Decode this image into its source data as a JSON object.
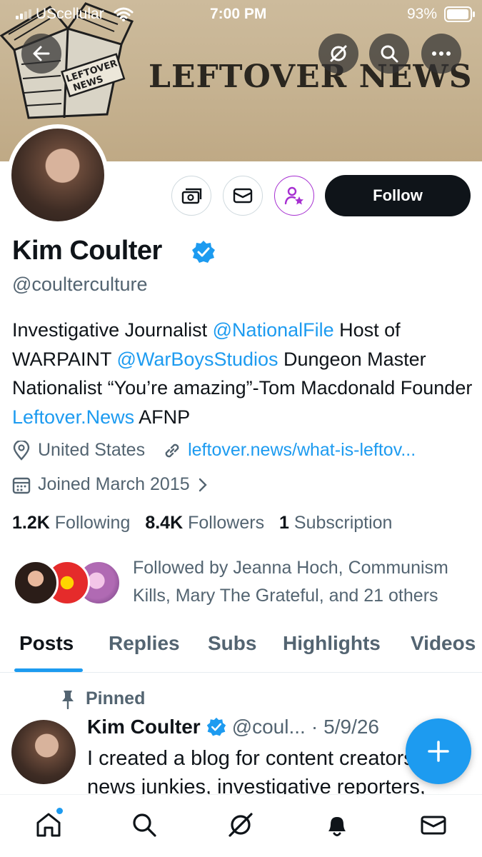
{
  "status_bar": {
    "carrier": "UScellular",
    "time": "7:00 PM",
    "battery": "93%"
  },
  "banner": {
    "title": "LEFTOVER NEWS",
    "logo_text": "LEFTOVER NEWS"
  },
  "profile": {
    "follow_label": "Follow",
    "name": "Kim Coulter",
    "handle": "@coulterculture",
    "bio": {
      "t1": "Investigative Journalist ",
      "l1": "@NationalFile",
      "t2": " Host of WARPAINT ",
      "l2": "@WarBoysStudios",
      "t3": " Dungeon Master Nationalist “You’re amazing”-Tom Macdonald Founder ",
      "l3": "Leftover.News",
      "t4": " AFNP"
    },
    "location": "United States",
    "website": "leftover.news/what-is-leftov...",
    "joined": "Joined March 2015",
    "following_count": "1.2K",
    "following_label": "Following",
    "followers_count": "8.4K",
    "followers_label": "Followers",
    "subscription_count": "1",
    "subscription_label": "Subscription",
    "followed_by": "Followed by Jeanna Hoch, Communism Kills, Mary The Grateful, and 21 others"
  },
  "tabs": [
    "Posts",
    "Replies",
    "Subs",
    "Highlights",
    "Videos"
  ],
  "post": {
    "pinned_label": "Pinned",
    "author": "Kim Coulter",
    "handle": "@coul...",
    "separator": "·",
    "date": "5/9/26",
    "text": "I created a blog for content creators, news junkies, investigative reporters,"
  },
  "colors": {
    "accent": "#1d9bf0",
    "text": "#0f1419",
    "muted": "#536471",
    "subscribe_purple": "#a62fd1"
  }
}
